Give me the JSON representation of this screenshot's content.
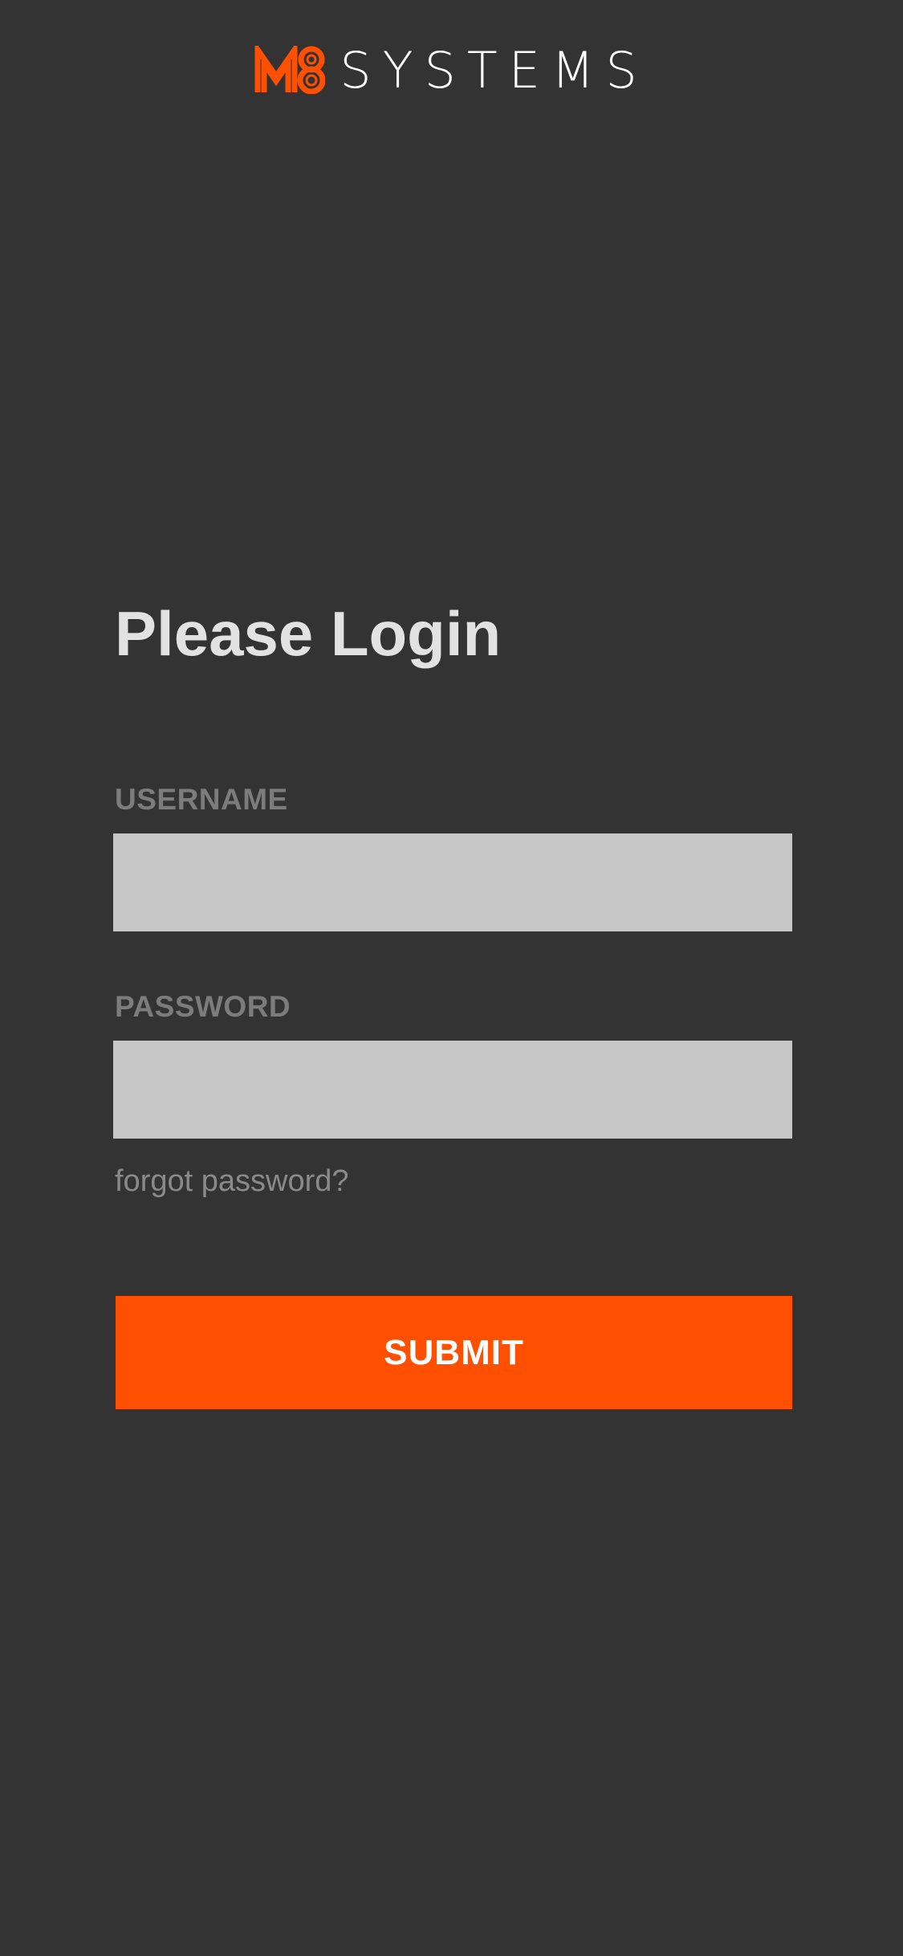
{
  "brand": {
    "mark_text": "M8",
    "name": "SYSTEMS",
    "accent_color": "#ff4f00"
  },
  "login": {
    "title": "Please Login",
    "username_label": "USERNAME",
    "username_value": "",
    "password_label": "PASSWORD",
    "password_value": "",
    "forgot_link": "forgot password?",
    "submit_label": "SUBMIT"
  },
  "colors": {
    "background": "#333333",
    "input_fill": "#c6c6c6",
    "label": "#7c7c7c",
    "title": "#e2e2e2",
    "button": "#ff4f00"
  }
}
